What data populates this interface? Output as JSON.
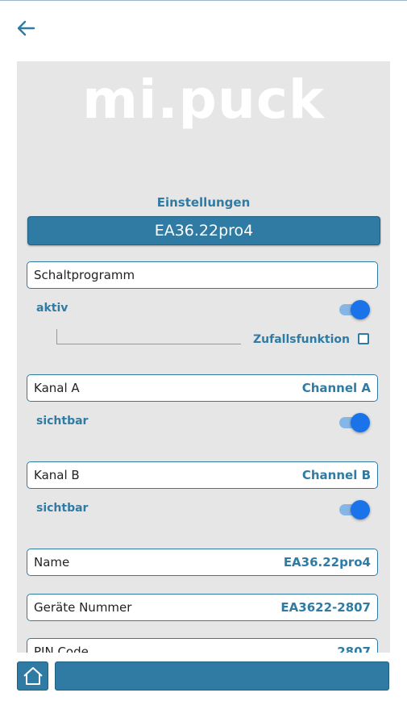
{
  "header": {
    "back_icon": "arrow-left-icon"
  },
  "logo": {
    "text": "mi.puck"
  },
  "settings": {
    "title": "Einstellungen",
    "device_button": "EA36.22pro4"
  },
  "schaltprogramm": {
    "label": "Schaltprogramm",
    "aktiv_label": "aktiv",
    "aktiv_on": true,
    "zufall_label": "Zufallsfunktion",
    "zufall_checked": false
  },
  "kanal_a": {
    "label": "Kanal A",
    "value": "Channel A",
    "visible_label": "sichtbar",
    "visible_on": true
  },
  "kanal_b": {
    "label": "Kanal B",
    "value": "Channel B",
    "visible_label": "sichtbar",
    "visible_on": true
  },
  "name_row": {
    "label": "Name",
    "value": "EA36.22pro4"
  },
  "geraete_row": {
    "label": "Geräte Nummer",
    "value": "EA3622-2807"
  },
  "pin_row": {
    "label": "PIN Code",
    "value": "2807"
  },
  "footer": {
    "home_icon": "home-icon"
  },
  "colors": {
    "accent": "#2f7ba3",
    "toggle_on": "#1a73e8",
    "panel_bg": "#e6e6e6"
  }
}
